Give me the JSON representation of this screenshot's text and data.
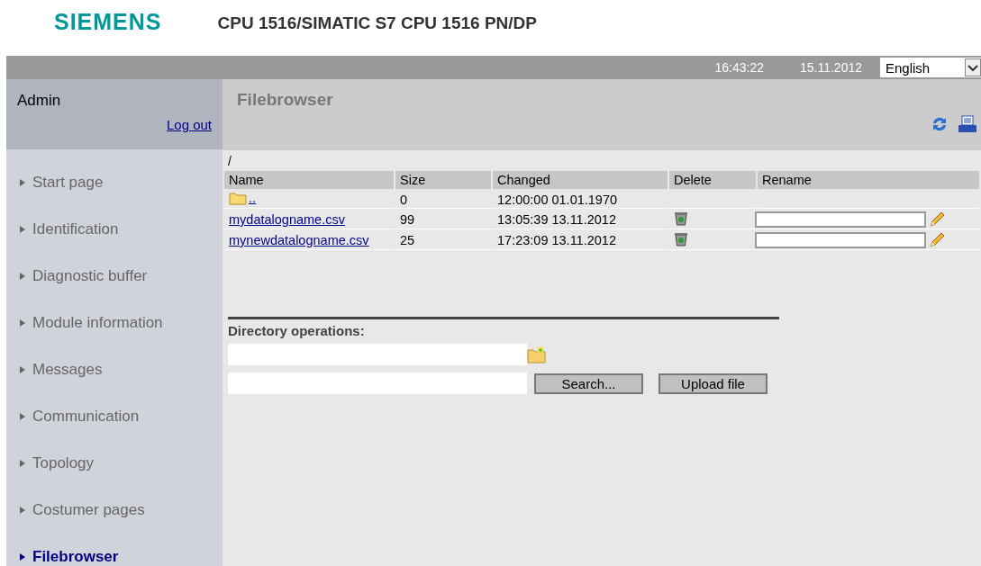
{
  "header": {
    "logo": "SIEMENS",
    "title": "CPU 1516/SIMATIC S7 CPU 1516 PN/DP"
  },
  "topbar": {
    "time": "16:43:22",
    "date": "15.11.2012",
    "language": "English"
  },
  "user": {
    "name": "Admin",
    "logout": "Log out"
  },
  "nav": [
    {
      "label": "Start page",
      "selected": false
    },
    {
      "label": "Identification",
      "selected": false
    },
    {
      "label": "Diagnostic buffer",
      "selected": false
    },
    {
      "label": "Module information",
      "selected": false
    },
    {
      "label": "Messages",
      "selected": false
    },
    {
      "label": "Communication",
      "selected": false
    },
    {
      "label": "Topology",
      "selected": false
    },
    {
      "label": "Costumer pages",
      "selected": false
    },
    {
      "label": "Filebrowser",
      "selected": true
    }
  ],
  "page": {
    "title": "Filebrowser",
    "path": "/"
  },
  "table": {
    "columns": [
      "Name",
      "Size",
      "Changed",
      "Delete",
      "Rename"
    ],
    "rows": [
      {
        "kind": "parent",
        "name": "..",
        "size": "0",
        "changed": "12:00:00 01.01.1970"
      },
      {
        "kind": "file",
        "name": "mydatalogname.csv",
        "size": "99",
        "changed": "13:05:39 13.11.2012"
      },
      {
        "kind": "file",
        "name": "mynewdatalogname.csv",
        "size": "25",
        "changed": "17:23:09 13.11.2012"
      }
    ]
  },
  "directory_operations": {
    "label": "Directory operations:",
    "search_button": "Search...",
    "upload_button": "Upload file"
  }
}
